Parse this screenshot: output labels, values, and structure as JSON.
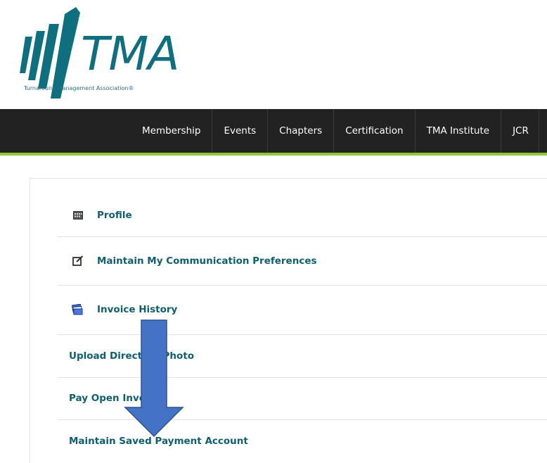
{
  "logo": {
    "text": "TMA",
    "tagline": "Turnaround Management Association®",
    "color": "#0f6f7e"
  },
  "nav": {
    "items": [
      "Membership",
      "Events",
      "Chapters",
      "Certification",
      "TMA Institute",
      "JCR"
    ],
    "background": "#222222",
    "accent": "#8ec63f"
  },
  "menu": {
    "items": [
      {
        "label": "Profile",
        "icon": "calendar-grid-icon"
      },
      {
        "label": "Maintain My Communication Preferences",
        "icon": "edit-note-icon"
      },
      {
        "label": "Invoice History",
        "icon": "stacked-documents-icon"
      },
      {
        "label": "Upload Directory Photo"
      },
      {
        "label": "Pay Open Invoices"
      },
      {
        "label": "Maintain Saved Payment Account"
      }
    ],
    "link_color": "#0f5f71"
  },
  "annotation": {
    "icon": "down-arrow-icon",
    "color": "#4472c4"
  }
}
